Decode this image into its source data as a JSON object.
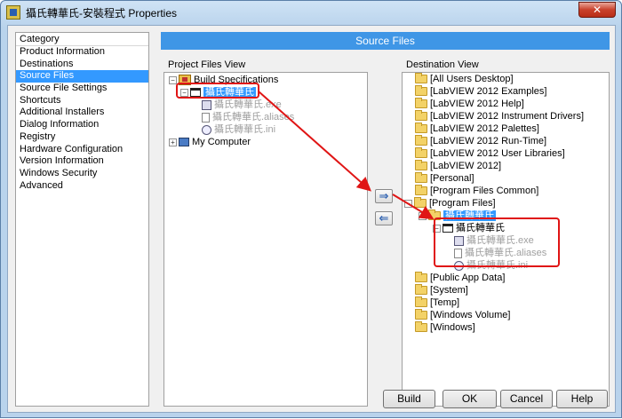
{
  "window": {
    "title": "攝氏轉華氏-安裝程式 Properties",
    "close_label": "✕"
  },
  "category": {
    "header": "Category",
    "items": [
      "Product Information",
      "Destinations",
      "Source Files",
      "Source File Settings",
      "Shortcuts",
      "Additional Installers",
      "Dialog Information",
      "Registry",
      "Hardware Configuration",
      "Version Information",
      "Windows Security",
      "Advanced"
    ],
    "selected_index": 2
  },
  "section_title": "Source Files",
  "project_view": {
    "label": "Project Files View",
    "build_specifications": "Build Specifications",
    "build_item": "攝氏轉華氏",
    "files": [
      "攝氏轉華氏.exe",
      "攝氏轉華氏.aliases",
      "攝氏轉華氏.ini"
    ],
    "my_computer": "My Computer"
  },
  "destination_view": {
    "label": "Destination View",
    "folders_before": [
      "[All Users Desktop]",
      "[LabVIEW 2012 Examples]",
      "[LabVIEW 2012 Help]",
      "[LabVIEW 2012 Instrument Drivers]",
      "[LabVIEW 2012 Palettes]",
      "[LabVIEW 2012 Run-Time]",
      "[LabVIEW 2012 User Libraries]",
      "[LabVIEW 2012]",
      "[Personal]",
      "[Program Files Common]",
      "[Program Files]"
    ],
    "program_files_child": "攝氏轉華氏",
    "installed_item": "攝氏轉華氏",
    "installed_files": [
      "攝氏轉華氏.exe",
      "攝氏轉華氏.aliases",
      "攝氏轉華氏.ini"
    ],
    "folders_after": [
      "[Public App Data]",
      "[System]",
      "[Temp]",
      "[Windows Volume]",
      "[Windows]"
    ]
  },
  "transfer": {
    "add_arrow": "⇒",
    "remove_arrow": "⇐"
  },
  "buttons": {
    "build": "Build",
    "ok": "OK",
    "cancel": "Cancel",
    "help": "Help"
  },
  "colors": {
    "accent": "#3f96e6",
    "selection": "#3399ff",
    "annotation": "#e01515"
  }
}
